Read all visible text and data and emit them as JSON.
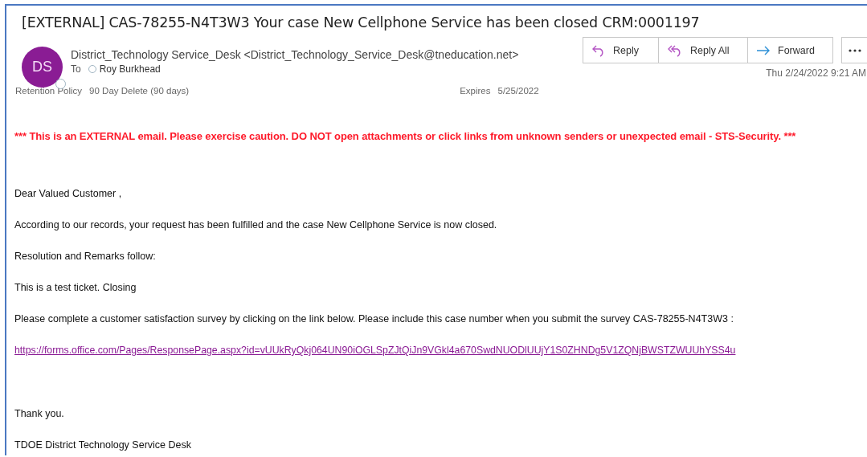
{
  "subject": "[EXTERNAL] CAS-78255-N4T3W3 Your case  New Cellphone Service  has been closed CRM:0001197",
  "sender": {
    "initials": "DS",
    "name": "District_Technology Service_Desk <District_Technology_Service_Desk@tneducation.net>"
  },
  "to": {
    "label": "To",
    "recipient": "Roy Burkhead"
  },
  "retention": {
    "label": "Retention Policy",
    "value": "90 Day Delete (90 days)"
  },
  "expires": {
    "label": "Expires",
    "value": "5/25/2022"
  },
  "actions": [
    {
      "kind": "reply",
      "label": "Reply"
    },
    {
      "kind": "reply_all",
      "label": "Reply All"
    },
    {
      "kind": "forward",
      "label": "Forward"
    }
  ],
  "date": "Thu 2/24/2022 9:21 AM",
  "warning": "*** This is an EXTERNAL email. Please exercise caution. DO NOT open attachments or click links from unknown senders or unexpected email - STS-Security. ***",
  "body": [
    {
      "kind": "paragraph",
      "text": "Dear Valued Customer ,"
    },
    {
      "kind": "paragraph",
      "text": "According to our records, your request has been fulfilled and the case New Cellphone Service is now closed."
    },
    {
      "kind": "paragraph",
      "text": "Resolution and Remarks follow:"
    },
    {
      "kind": "paragraph",
      "text": " This is a test ticket. Closing"
    },
    {
      "kind": "paragraph",
      "text": "Please complete a customer satisfaction survey by clicking on the link below. Please include this case number when you submit the survey CAS-78255-N4T3W3 :"
    },
    {
      "kind": "link",
      "text": "https://forms.office.com/Pages/ResponsePage.aspx?id=vUUkRyQkj064UN90iOGLSpZJtQiJn9VGkl4a670SwdNUODlUUjY1S0ZHNDg5V1ZQNjBWSTZWUUhYSS4u"
    },
    {
      "kind": "paragraph",
      "text": "Thank you."
    },
    {
      "kind": "paragraph",
      "text": "TDOE District Technology Service Desk"
    }
  ]
}
